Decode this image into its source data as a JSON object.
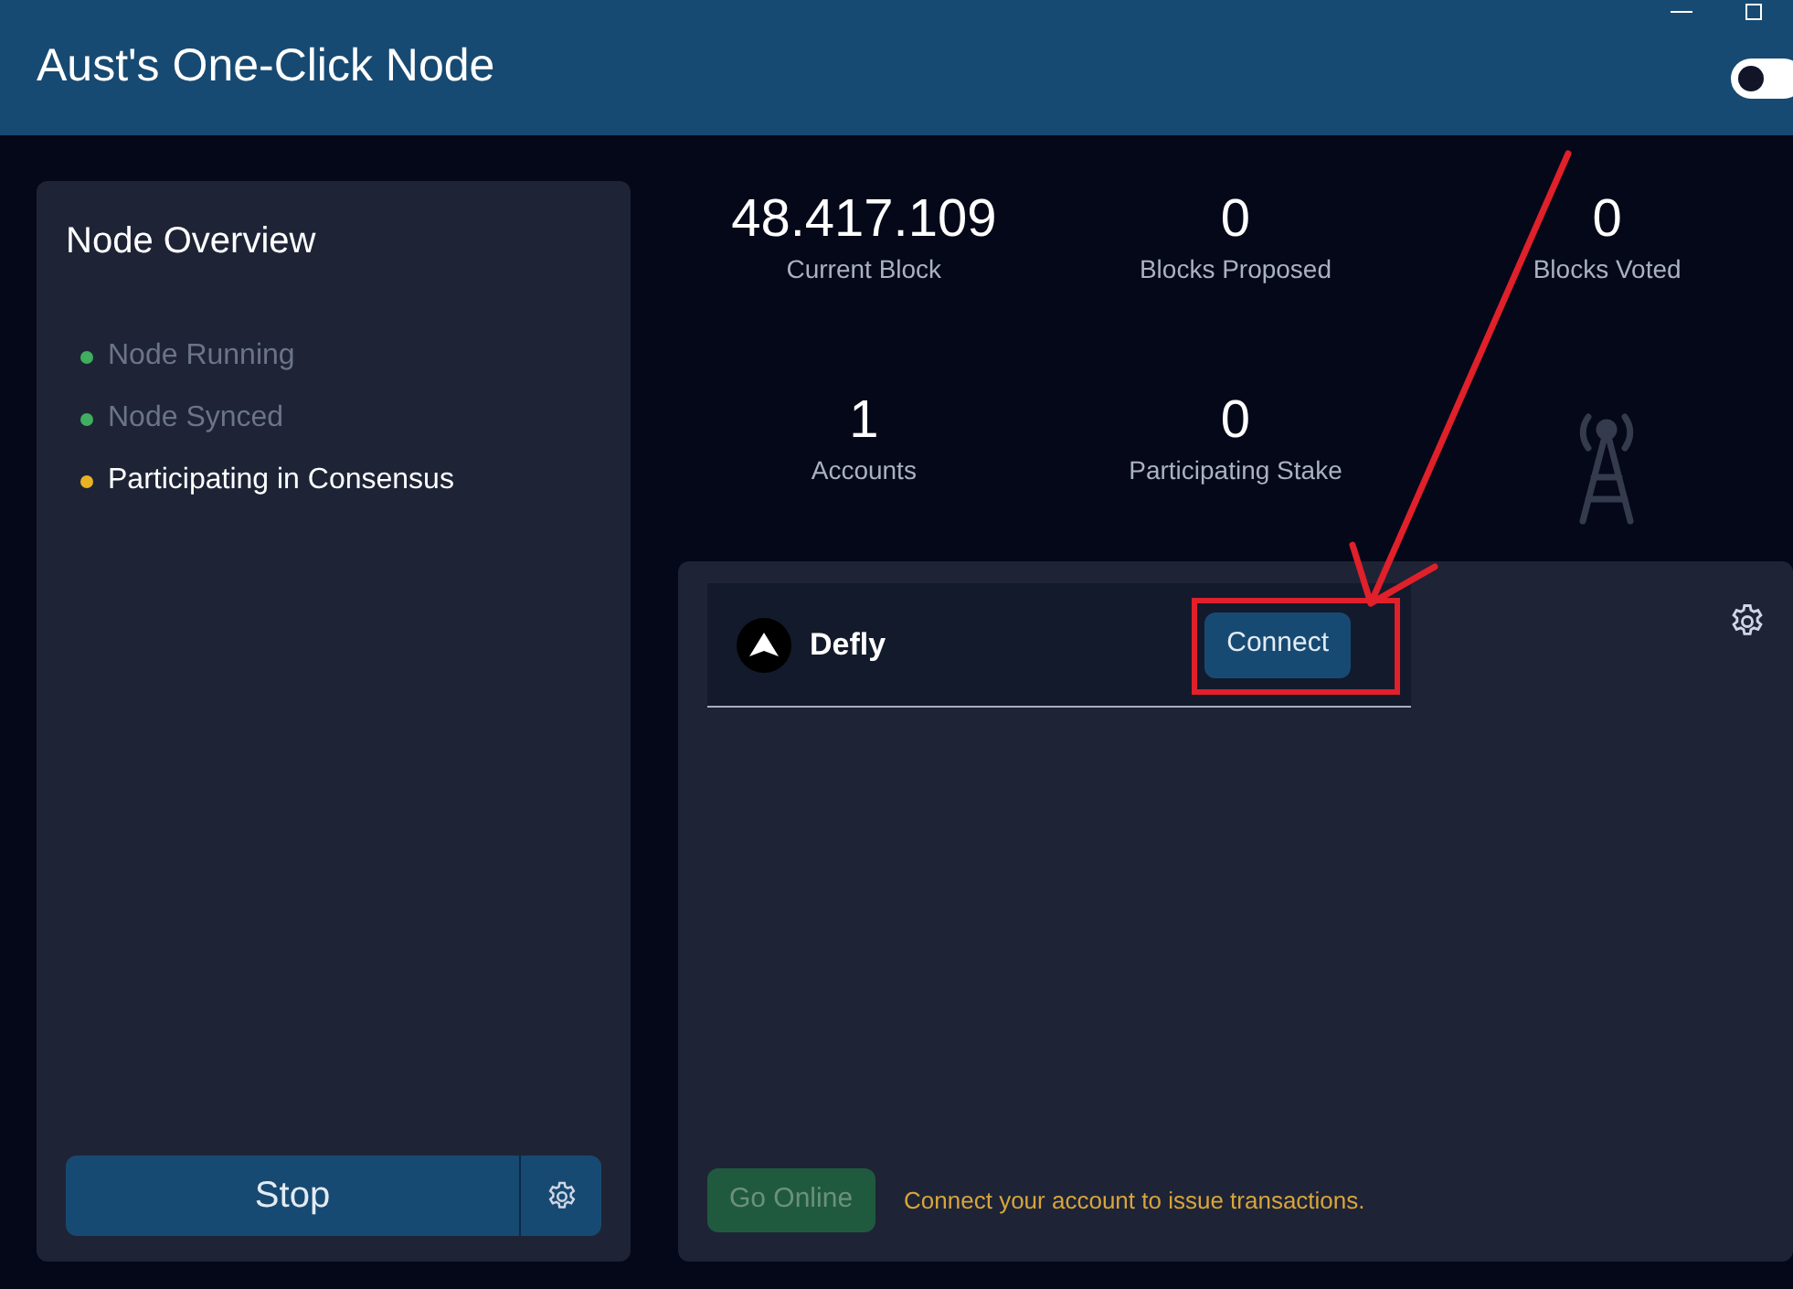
{
  "window": {
    "title": "Aust's One-Click Node"
  },
  "theme_toggle": {
    "on": false
  },
  "overview": {
    "title": "Node Overview",
    "statuses": [
      {
        "label": "Node Running",
        "color": "#3fae5f",
        "active": false
      },
      {
        "label": "Node Synced",
        "color": "#3fae5f",
        "active": false
      },
      {
        "label": "Participating in Consensus",
        "color": "#e8b323",
        "active": true
      }
    ],
    "stop_button": "Stop"
  },
  "stats": [
    {
      "value": "48.417.109",
      "label": "Current Block"
    },
    {
      "value": "0",
      "label": "Blocks Proposed"
    },
    {
      "value": "0",
      "label": "Blocks Voted"
    },
    {
      "value": "1",
      "label": "Accounts"
    },
    {
      "value": "0",
      "label": "Participating Stake"
    }
  ],
  "wallets": [
    {
      "name": "Defly",
      "button": "Connect"
    }
  ],
  "footer": {
    "go_online": {
      "label": "Go Online",
      "disabled": true
    },
    "message": "Connect your account to issue transactions."
  }
}
